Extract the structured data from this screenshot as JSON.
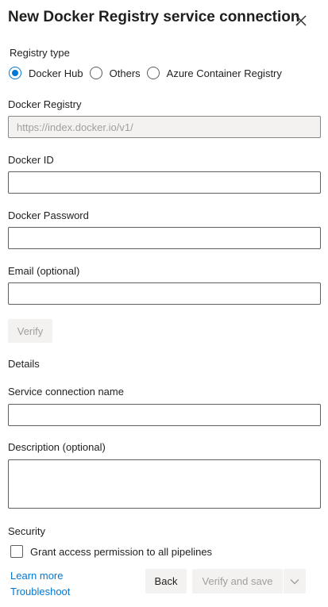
{
  "dialog": {
    "title": "New Docker Registry service connection"
  },
  "registry_type": {
    "label": "Registry type",
    "options": [
      {
        "label": "Docker Hub",
        "selected": true
      },
      {
        "label": "Others",
        "selected": false
      },
      {
        "label": "Azure Container Registry",
        "selected": false
      }
    ]
  },
  "docker_registry": {
    "label": "Docker Registry",
    "placeholder": "https://index.docker.io/v1/"
  },
  "docker_id": {
    "label": "Docker ID",
    "value": ""
  },
  "docker_password": {
    "label": "Docker Password",
    "value": ""
  },
  "email": {
    "label": "Email (optional)",
    "value": ""
  },
  "verify_label": "Verify",
  "details_heading": "Details",
  "service_connection_name": {
    "label": "Service connection name",
    "value": ""
  },
  "description": {
    "label": "Description (optional)",
    "value": ""
  },
  "security": {
    "heading": "Security",
    "grant_access_label": "Grant access permission to all pipelines",
    "grant_access_checked": false
  },
  "links": {
    "learn_more": "Learn more",
    "troubleshoot": "Troubleshoot"
  },
  "footer": {
    "back_label": "Back",
    "verify_and_save_label": "Verify and save"
  },
  "colors": {
    "accent": "#0078d4",
    "disabled_bg": "#f3f2f1",
    "disabled_text": "#a19f9d"
  }
}
